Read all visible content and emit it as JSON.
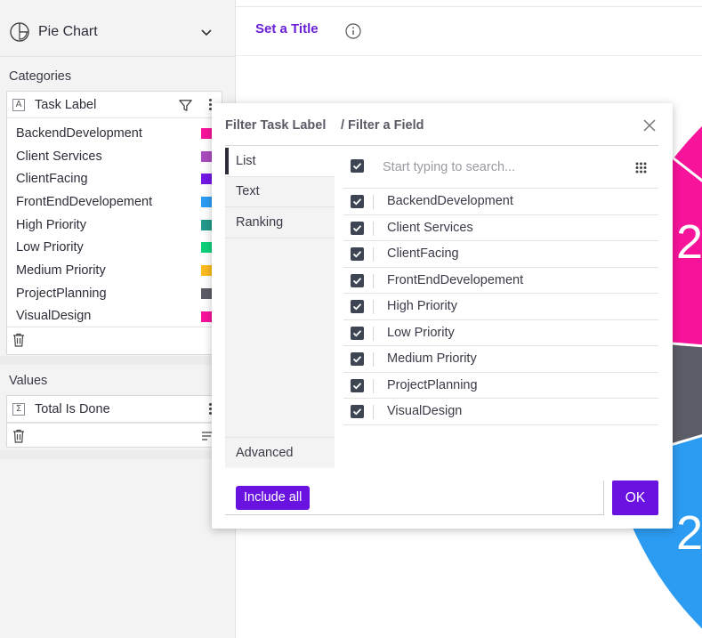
{
  "chart_type": {
    "label": "Pie Chart"
  },
  "header": {
    "title_placeholder": "Set a Title"
  },
  "categories": {
    "section_title": "Categories",
    "field_type_badge": "A",
    "field_name": "Task Label",
    "items": [
      {
        "label": "BackendDevelopment",
        "color": "#f7139a"
      },
      {
        "label": "Client Services",
        "color": "#a94dbf"
      },
      {
        "label": "ClientFacing",
        "color": "#7418e6"
      },
      {
        "label": "FrontEndDevelopement",
        "color": "#2c9cf2"
      },
      {
        "label": "High Priority",
        "color": "#22998a"
      },
      {
        "label": "Low Priority",
        "color": "#0fd07a"
      },
      {
        "label": "Medium Priority",
        "color": "#fbbb1f"
      },
      {
        "label": "ProjectPlanning",
        "color": "#5c5c66"
      },
      {
        "label": "VisualDesign",
        "color": "#f7139a"
      }
    ]
  },
  "values": {
    "section_title": "Values",
    "field_type_badge": "Σ",
    "field_name": "Total Is Done"
  },
  "dialog": {
    "title": "Filter Task Label",
    "subtitle": "/ Filter a Field",
    "tabs": [
      "List",
      "Text",
      "Ranking"
    ],
    "active_tab": "List",
    "advanced_tab": "Advanced",
    "search_placeholder": "Start typing to search...",
    "items": [
      {
        "label": "BackendDevelopment",
        "checked": true
      },
      {
        "label": "Client Services",
        "checked": true
      },
      {
        "label": "ClientFacing",
        "checked": true
      },
      {
        "label": "FrontEndDevelopement",
        "checked": true
      },
      {
        "label": "High Priority",
        "checked": true
      },
      {
        "label": "Low Priority",
        "checked": true
      },
      {
        "label": "Medium Priority",
        "checked": true
      },
      {
        "label": "ProjectPlanning",
        "checked": true
      },
      {
        "label": "VisualDesign",
        "checked": true
      }
    ],
    "include_all_label": "Include all",
    "ok_label": "OK"
  },
  "pie_visible_labels": [
    "2",
    "2"
  ],
  "colors": {
    "accent": "#6a12e0",
    "pie_pink": "#f7139a",
    "pie_gray": "#5c5c66",
    "pie_blue": "#2c9cf2"
  }
}
